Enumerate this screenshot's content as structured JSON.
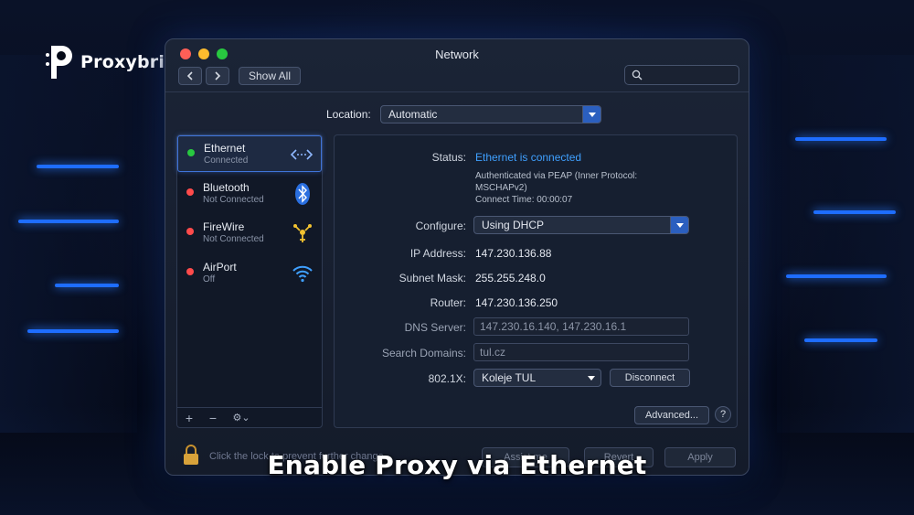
{
  "brand": {
    "name": "Proxybrief",
    "logo": "proxybrief-logo"
  },
  "window": {
    "title": "Network",
    "back_icon": "chevron-left-icon",
    "forward_icon": "chevron-right-icon",
    "show_all": "Show All",
    "search_placeholder": "",
    "search_icon": "search-icon"
  },
  "location": {
    "label": "Location:",
    "value": "Automatic"
  },
  "services": [
    {
      "name": "Ethernet",
      "status": "Connected",
      "dot": "#28c840",
      "icon": "ethernet-icon",
      "selected": true
    },
    {
      "name": "Bluetooth",
      "status": "Not Connected",
      "dot": "#ff4b4b",
      "icon": "bluetooth-icon",
      "selected": false
    },
    {
      "name": "FireWire",
      "status": "Not Connected",
      "dot": "#ff4b4b",
      "icon": "firewire-icon",
      "selected": false
    },
    {
      "name": "AirPort",
      "status": "Off",
      "dot": "#ff4b4b",
      "icon": "wifi-icon",
      "selected": false
    }
  ],
  "sidebar_footer": {
    "add": "+",
    "remove": "−",
    "gear": "⚙⌄"
  },
  "detail": {
    "status_label": "Status:",
    "status_value": "Ethernet is connected",
    "status_note_1": "Authenticated via PEAP (Inner Protocol:",
    "status_note_2": "MSCHAPv2)",
    "connect_time": "Connect Time: 00:00:07",
    "configure_label": "Configure:",
    "configure_value": "Using DHCP",
    "ip_label": "IP Address:",
    "ip_value": "147.230.136.88",
    "subnet_label": "Subnet Mask:",
    "subnet_value": "255.255.248.0",
    "router_label": "Router:",
    "router_value": "147.230.136.250",
    "dns_label": "DNS Server:",
    "dns_value": "147.230.16.140, 147.230.16.1",
    "domains_label": "Search Domains:",
    "domains_value": "tul.cz",
    "dot1x_label": "802.1X:",
    "dot1x_value": "Koleje TUL",
    "disconnect": "Disconnect",
    "advanced": "Advanced...",
    "help": "?"
  },
  "bottom": {
    "lock_icon": "lock-icon",
    "lock_text": "Click the lock to prevent further change",
    "assist": "Assist me",
    "revert": "Revert",
    "apply": "Apply"
  },
  "caption": "Enable Proxy via Ethernet",
  "colors": {
    "accent": "#3fa0ff",
    "connected": "#28c840",
    "disconnected": "#ff4b4b"
  }
}
